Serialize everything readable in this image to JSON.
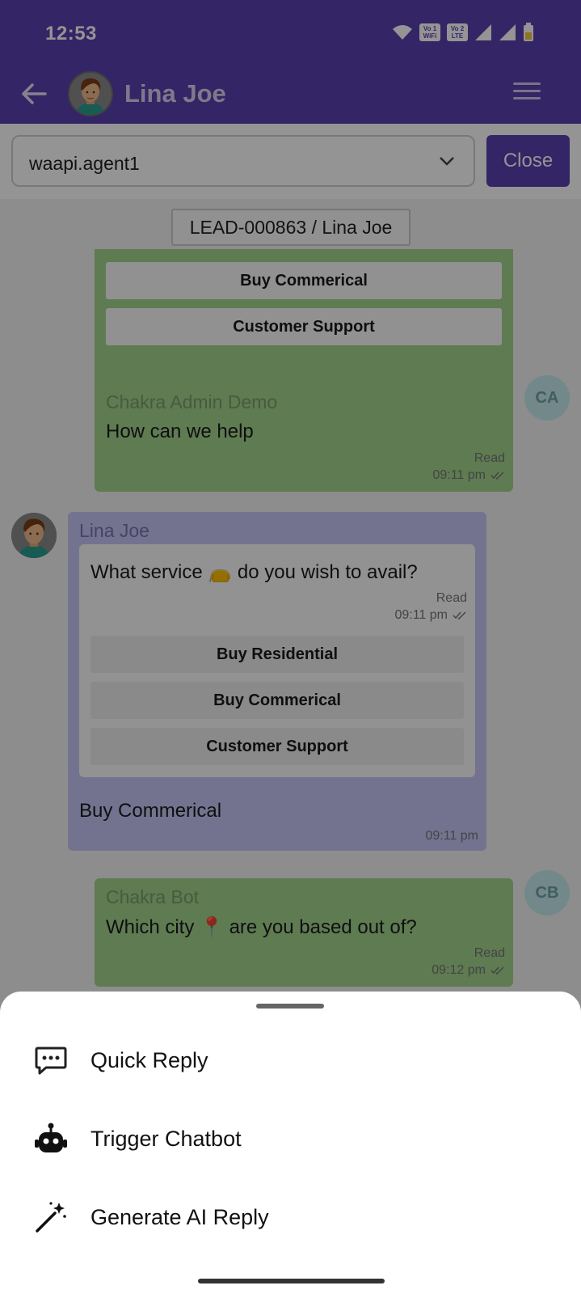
{
  "status_bar": {
    "time": "12:53",
    "volte1": "Vo 1 WiFi",
    "volte2": "Vo 2 LTE"
  },
  "header": {
    "contact_name": "Lina Joe",
    "back_icon": "arrow-left-icon",
    "menu_icon": "hamburger-menu-icon"
  },
  "agent_bar": {
    "selected_agent": "waapi.agent1",
    "close_label": "Close"
  },
  "chat": {
    "lead_label": "LEAD-000863 / Lina Joe",
    "top_options": [
      "Buy Commerical",
      "Customer Support"
    ],
    "msg1": {
      "sender": "Chakra Admin Demo",
      "text": "How can we help",
      "status": "Read",
      "time": "09:11 pm",
      "initials": "CA"
    },
    "msg2": {
      "sender": "Lina Joe",
      "quoted_text": "What service 👝 do you wish to avail?",
      "quoted_status": "Read",
      "quoted_time": "09:11 pm",
      "options": [
        "Buy Residential",
        "Buy Commerical",
        "Customer Support"
      ],
      "reply": "Buy Commerical",
      "time": "09:11 pm"
    },
    "msg3": {
      "sender": "Chakra Bot",
      "text": "Which city 📍 are you based out of?",
      "status": "Read",
      "time": "09:12 pm",
      "initials": "CB"
    }
  },
  "sheet": {
    "items": [
      {
        "label": "Quick Reply",
        "icon": "chat-bubble-dots-icon"
      },
      {
        "label": "Trigger Chatbot",
        "icon": "robot-icon"
      },
      {
        "label": "Generate AI Reply",
        "icon": "magic-wand-icon"
      }
    ]
  },
  "colors": {
    "primary": "#5a41b0",
    "outgoing_bubble": "#a3d48e",
    "incoming_bubble": "#c9c6f6"
  }
}
